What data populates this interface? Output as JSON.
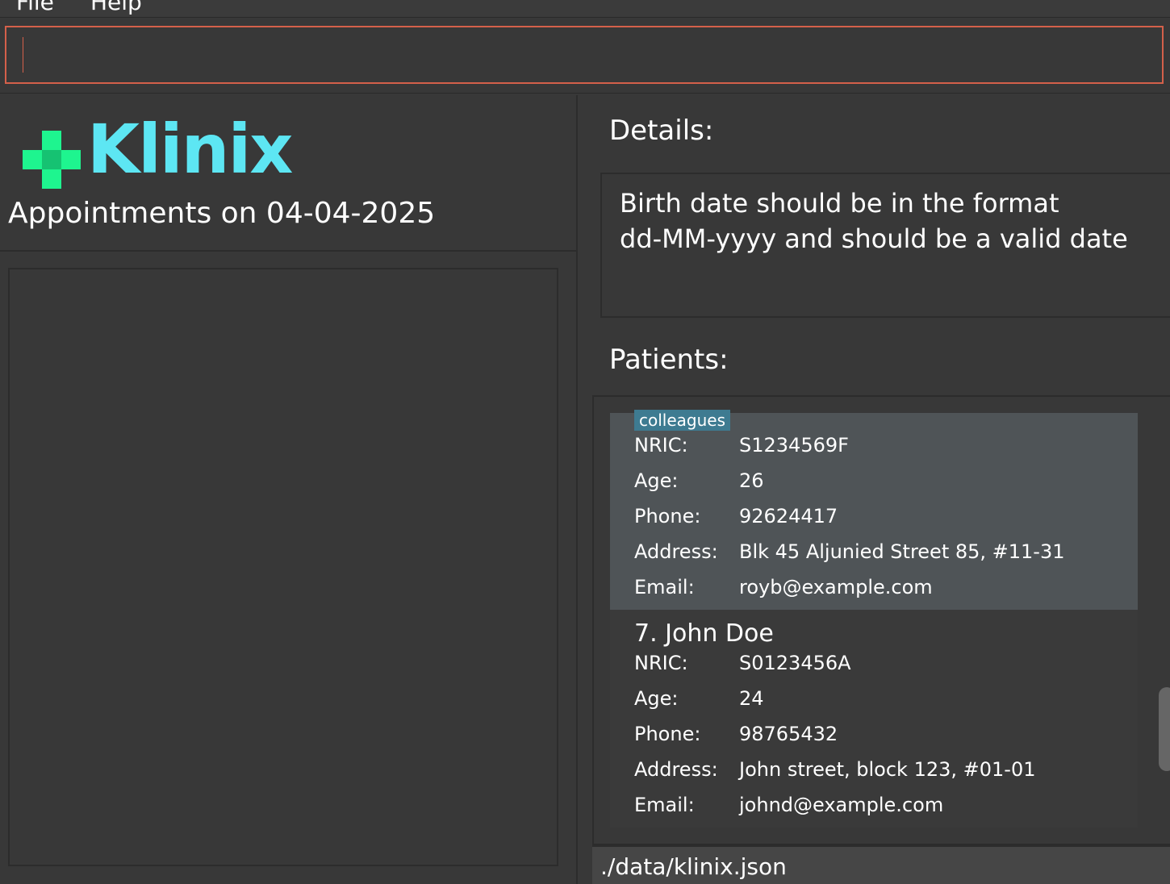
{
  "menu": {
    "file_label": "File",
    "help_label": "Help"
  },
  "command_box": {
    "value": "",
    "placeholder": ""
  },
  "logo": {
    "text": "Klinix",
    "icon": "plus-cross-icon",
    "icon_color": "#1ef58f",
    "text_color": "#5de6f3"
  },
  "appointments": {
    "title": "Appointments on 04-04-2025"
  },
  "details": {
    "label": "Details:",
    "message_line1": "Birth date should be in the format",
    "message_line2": "dd-MM-yyyy and should be a valid date"
  },
  "patients": {
    "label": "Patients:",
    "field_labels": {
      "nric": "NRIC:",
      "age": "Age:",
      "phone": "Phone:",
      "address": "Address:",
      "email": "Email:"
    },
    "cards": [
      {
        "tag": "colleagues",
        "nric": "S1234569F",
        "age": "26",
        "phone": "92624417",
        "address": "Blk 45 Aljunied Street 85, #11-31",
        "email": "royb@example.com",
        "selected": true
      },
      {
        "name": "7. John Doe",
        "nric": "S0123456A",
        "age": "24",
        "phone": "98765432",
        "address": "John street, block 123, #01-01",
        "email": "johnd@example.com",
        "selected": false
      }
    ]
  },
  "status_bar": {
    "file_path": "./data/klinix.json"
  },
  "colors": {
    "background": "#383838",
    "command_border": "#d4604a",
    "selected_card": "#4f5457",
    "tag_background": "#3e7b91"
  }
}
